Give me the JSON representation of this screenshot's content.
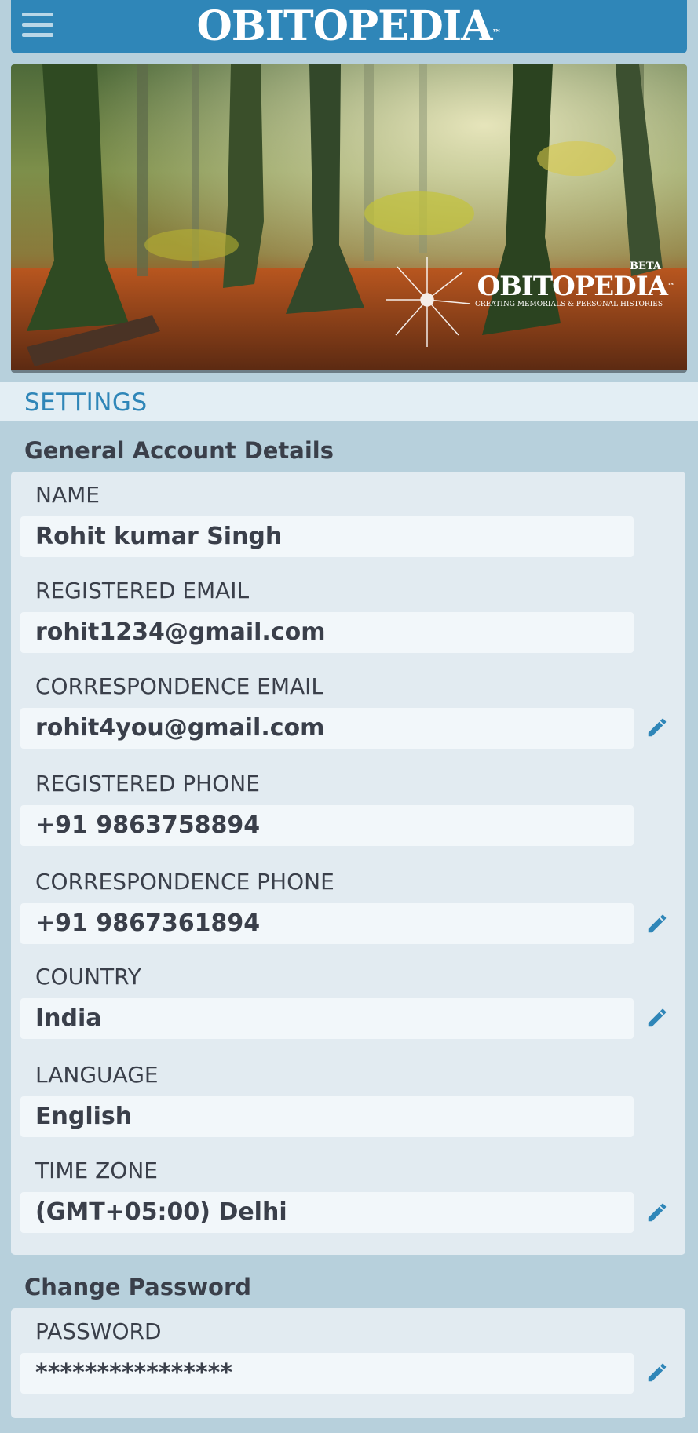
{
  "header": {
    "brand": "OBITOPEDIA",
    "trademark": "™",
    "menu_icon": "hamburger-menu-icon"
  },
  "banner": {
    "beta": "BETA",
    "brand": "OBITOPEDIA",
    "tagline": "CREATING MEMORIALS & PERSONAL HISTORIES",
    "trademark": "™"
  },
  "settings": {
    "title": "SETTINGS"
  },
  "general": {
    "title": "General Account Details",
    "fields": [
      {
        "label": "NAME",
        "value": "Rohit kumar Singh",
        "editable": false
      },
      {
        "label": "REGISTERED EMAIL",
        "value": "rohit1234@gmail.com",
        "editable": false
      },
      {
        "label": "CORRESPONDENCE EMAIL",
        "value": "rohit4you@gmail.com",
        "editable": true
      },
      {
        "label": "REGISTERED PHONE",
        "value": "+91 9863758894",
        "editable": false
      },
      {
        "label": "CORRESPONDENCE PHONE",
        "value": "+91 9867361894",
        "editable": true
      },
      {
        "label": "COUNTRY",
        "value": "India",
        "editable": true
      },
      {
        "label": "LANGUAGE",
        "value": "English",
        "editable": false
      },
      {
        "label": "TIME ZONE",
        "value": "(GMT+05:00) Delhi",
        "editable": true
      }
    ]
  },
  "password": {
    "title": "Change Password",
    "label": "PASSWORD",
    "value": "****************"
  },
  "colors": {
    "header": "#2f86b8",
    "page_bg": "#b7d0dc",
    "card_bg": "#e2ebf1",
    "field_bg": "#f2f7fa",
    "accent": "#2f86b8"
  },
  "icons": {
    "edit": "pencil-icon"
  }
}
